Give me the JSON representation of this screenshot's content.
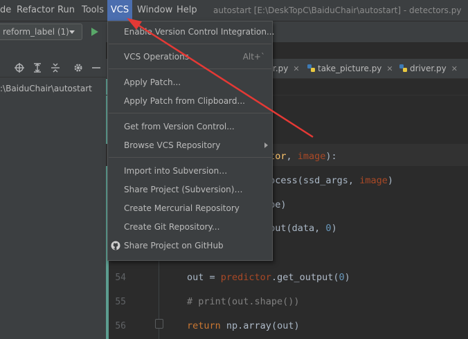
{
  "menubar": {
    "items": [
      "de",
      "Refactor",
      "Run",
      "Tools",
      "VCS",
      "Window",
      "Help"
    ],
    "window_title": "autostart [E:\\DeskTopC\\BaiduChair\\autostart] - detectors.py"
  },
  "toolbar": {
    "run_config": "reform_label (1)"
  },
  "project": {
    "path": ":\\BaiduChair\\autostart"
  },
  "tabs": [
    {
      "label": "r.py"
    },
    {
      "label": "take_picture.py"
    },
    {
      "label": "driver.py"
    }
  ],
  "vcs_menu": {
    "items": [
      {
        "label": "Enable Version Control Integration...",
        "shortcut": ""
      },
      {
        "label": "VCS Operations",
        "shortcut": "Alt+`"
      },
      {
        "label": "Apply Patch...",
        "shortcut": ""
      },
      {
        "label": "Apply Patch from Clipboard...",
        "shortcut": ""
      },
      {
        "label": "Get from Version Control...",
        "shortcut": ""
      },
      {
        "label": "Browse VCS Repository",
        "shortcut": ""
      },
      {
        "label": "Import into Subversion…",
        "shortcut": ""
      },
      {
        "label": "Share Project (Subversion)…",
        "shortcut": ""
      },
      {
        "label": "Create Mercurial Repository",
        "shortcut": ""
      },
      {
        "label": "Create Git Repository...",
        "shortcut": ""
      },
      {
        "label": "Share Project on GitHub",
        "shortcut": ""
      }
    ]
  },
  "code": {
    "line1": {
      "a": "ctor",
      "b": ", ",
      "c": "image",
      "d": "):"
    },
    "line2": {
      "a": "rocess",
      "b": "(ssd_args, ",
      "c": "image",
      "d": ")"
    },
    "line3": {
      "a": "ape",
      "b": ")"
    },
    "line4": {
      "a": "nput",
      "b": "(data, ",
      "c": "0",
      "d": ")"
    },
    "line54": {
      "num": "54",
      "a": "out = ",
      "b": "predictor",
      "c": ".",
      "d": "get_output",
      "e": "(",
      "f": "0",
      "g": ")"
    },
    "line55": {
      "num": "55",
      "text": "# print(out.shape())"
    },
    "line56": {
      "num": "56",
      "kw": "return ",
      "a": "np.",
      "b": "array",
      "c": "(out)"
    }
  },
  "colors": {
    "highlight": "#4b6eaf",
    "annotation_arrow": "#e53935"
  }
}
